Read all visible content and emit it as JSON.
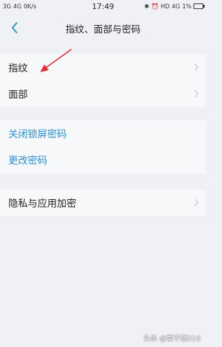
{
  "statusbar": {
    "sig1": "3G",
    "sig2": "4G",
    "speed": "0K/s",
    "time": "17:49",
    "hd": "HD",
    "net": "4G",
    "battery": "1%"
  },
  "header": {
    "title": "指纹、面部与密码"
  },
  "groups": [
    {
      "items": [
        {
          "label": "指纹"
        },
        {
          "label": "面部"
        }
      ]
    },
    {
      "items": [
        {
          "label": "关闭锁屏密码"
        },
        {
          "label": "更改密码"
        }
      ]
    },
    {
      "items": [
        {
          "label": "隐私与应用加密"
        }
      ]
    }
  ],
  "colors": {
    "accent": "#2b8fd6",
    "annotation_arrow": "#e8262c",
    "background": "#eff1f4"
  },
  "watermark": "头条 @雷不通316"
}
